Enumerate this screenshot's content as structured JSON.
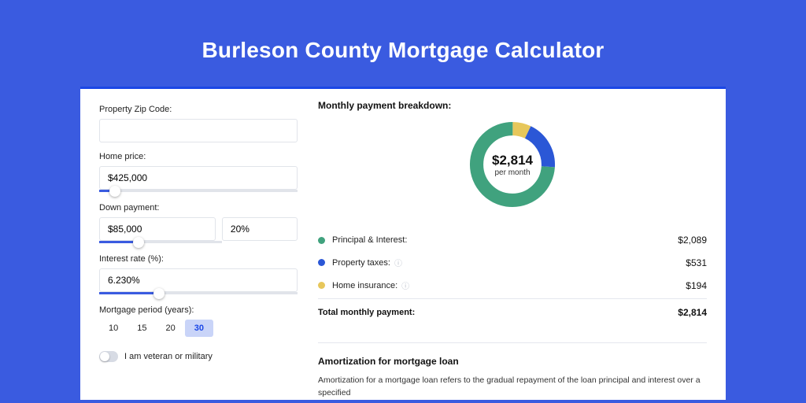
{
  "title": "Burleson County Mortgage Calculator",
  "form": {
    "zip": {
      "label": "Property Zip Code:",
      "value": ""
    },
    "home_price": {
      "label": "Home price:",
      "value": "$425,000",
      "slider_pct": 8
    },
    "down_payment": {
      "label": "Down payment:",
      "value": "$85,000",
      "pct": "20%",
      "slider_pct": 20
    },
    "interest_rate": {
      "label": "Interest rate (%):",
      "value": "6.230%",
      "slider_pct": 30
    },
    "period": {
      "label": "Mortgage period (years):",
      "options": [
        "10",
        "15",
        "20",
        "30"
      ],
      "selected": "30"
    },
    "veteran": {
      "label": "I am veteran or military",
      "checked": false
    }
  },
  "breakdown": {
    "title": "Monthly payment breakdown:",
    "center_amount": "$2,814",
    "center_sub": "per month",
    "items": [
      {
        "dot": "green",
        "label": "Principal & Interest:",
        "info": "",
        "value": "$2,089",
        "pct": 74
      },
      {
        "dot": "blue",
        "label": "Property taxes:",
        "info": "ⓘ",
        "value": "$531",
        "pct": 19
      },
      {
        "dot": "yellow",
        "label": "Home insurance:",
        "info": "ⓘ",
        "value": "$194",
        "pct": 7
      }
    ],
    "total_label": "Total monthly payment:",
    "total_value": "$2,814"
  },
  "amort": {
    "title": "Amortization for mortgage loan",
    "text": "Amortization for a mortgage loan refers to the gradual repayment of the loan principal and interest over a specified"
  },
  "chart_data": {
    "type": "pie",
    "title": "Monthly payment breakdown",
    "series": [
      {
        "name": "Principal & Interest",
        "value": 2089,
        "color": "#40a27e"
      },
      {
        "name": "Property taxes",
        "value": 531,
        "color": "#2b57d6"
      },
      {
        "name": "Home insurance",
        "value": 194,
        "color": "#e7c75b"
      }
    ],
    "total": 2814,
    "center_label": "$2,814 per month"
  }
}
